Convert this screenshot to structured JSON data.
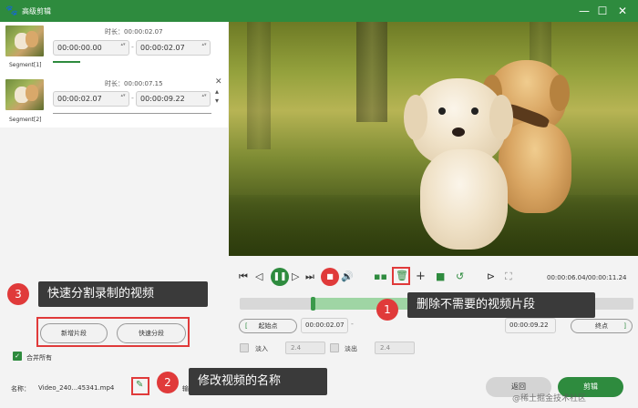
{
  "window": {
    "title": "高级剪辑",
    "logo_icon": "dog-logo-icon",
    "min_icon": "—",
    "max_icon": "☐",
    "close_icon": "✕"
  },
  "segments": [
    {
      "label": "Segment[1]",
      "duration": "时长：00:00:02.07",
      "start": "00:00:00.00",
      "end": "00:00:02.07",
      "dash": "-"
    },
    {
      "label": "Segment[2]",
      "duration": "时长：00:00:07.15",
      "start": "00:00:02.07",
      "end": "00:00:09.22",
      "dash": "-"
    }
  ],
  "segment_close": "✕",
  "segment_up": "▴",
  "segment_down": "▾",
  "spinner": "▴▾",
  "player": {
    "time": "00:00:06.04/00:00:11.24",
    "icons": [
      "skip-start-icon",
      "prev-frame-icon",
      "play-pause-icon",
      "next-frame-icon",
      "skip-end-icon",
      "stop-icon",
      "volume-icon",
      "split-icon",
      "delete-icon",
      "add-icon",
      "copy-icon",
      "reset-icon",
      "snapshot-icon",
      "fullscreen-icon"
    ]
  },
  "trim": {
    "start_btn": "起始点",
    "start_time": "00:00:02.07",
    "end_time": "00:00:09.22",
    "end_btn": "终点",
    "bracket_left": "[",
    "bracket_right": "]",
    "dash": "-"
  },
  "fade": {
    "in_label": "淡入",
    "in_value": "2.4",
    "out_label": "淡出",
    "out_value": "2.4"
  },
  "left_buttons": {
    "new_segment": "新增片段",
    "quick_split": "快速分段"
  },
  "merge_all": "合并所有",
  "name": {
    "label": "名称：",
    "value": "Video_240...45341.mp4",
    "output_label": "输"
  },
  "footer": {
    "return": "返回",
    "edit": "剪辑",
    "watermark": "@稀土掘金技术社区"
  },
  "callouts": [
    {
      "num": "1",
      "text": "删除不需要的视频片段"
    },
    {
      "num": "2",
      "text": "修改视频的名称"
    },
    {
      "num": "3",
      "text": "快速分割录制的视频"
    }
  ],
  "colors": {
    "accent": "#2e8b3e",
    "danger": "#e03a3a"
  }
}
